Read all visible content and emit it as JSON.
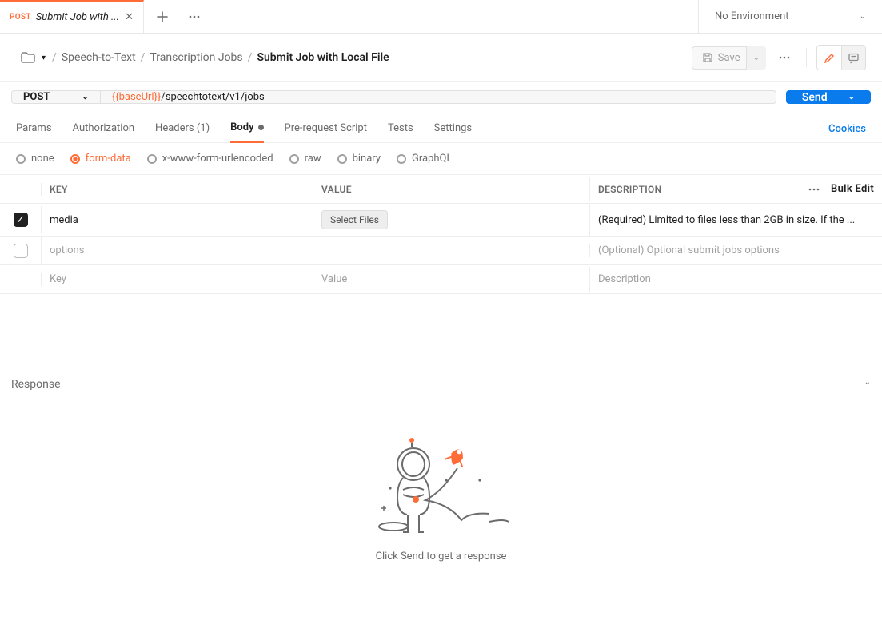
{
  "tab": {
    "method": "POST",
    "title": "Submit Job with ..."
  },
  "env": {
    "label": "No Environment"
  },
  "breadcrumb": {
    "items": [
      "Speech-to-Text",
      "Transcription Jobs"
    ],
    "current": "Submit Job with Local File"
  },
  "header_actions": {
    "save": "Save"
  },
  "request": {
    "method": "POST",
    "url_var": "{{baseUrl}}",
    "url_path": "/speechtotext/v1/jobs",
    "send": "Send"
  },
  "req_tabs": {
    "params": "Params",
    "auth": "Authorization",
    "headers": "Headers (1)",
    "body": "Body",
    "prerequest": "Pre-request Script",
    "tests": "Tests",
    "settings": "Settings",
    "cookies": "Cookies"
  },
  "body_types": {
    "none": "none",
    "formdata": "form-data",
    "xwww": "x-www-form-urlencoded",
    "raw": "raw",
    "binary": "binary",
    "graphql": "GraphQL"
  },
  "fd_table": {
    "head": {
      "key": "KEY",
      "value": "VALUE",
      "desc": "DESCRIPTION",
      "bulk": "Bulk Edit"
    },
    "rows": [
      {
        "checked": true,
        "key": "media",
        "value_btn": "Select Files",
        "desc": "(Required) Limited to files less than 2GB in size. If the ..."
      },
      {
        "checked": false,
        "key": "options",
        "value": "",
        "desc": "(Optional) Optional submit jobs options"
      }
    ],
    "placeholder": {
      "key": "Key",
      "value": "Value",
      "desc": "Description"
    }
  },
  "response": {
    "title": "Response",
    "empty_msg": "Click Send to get a response"
  }
}
